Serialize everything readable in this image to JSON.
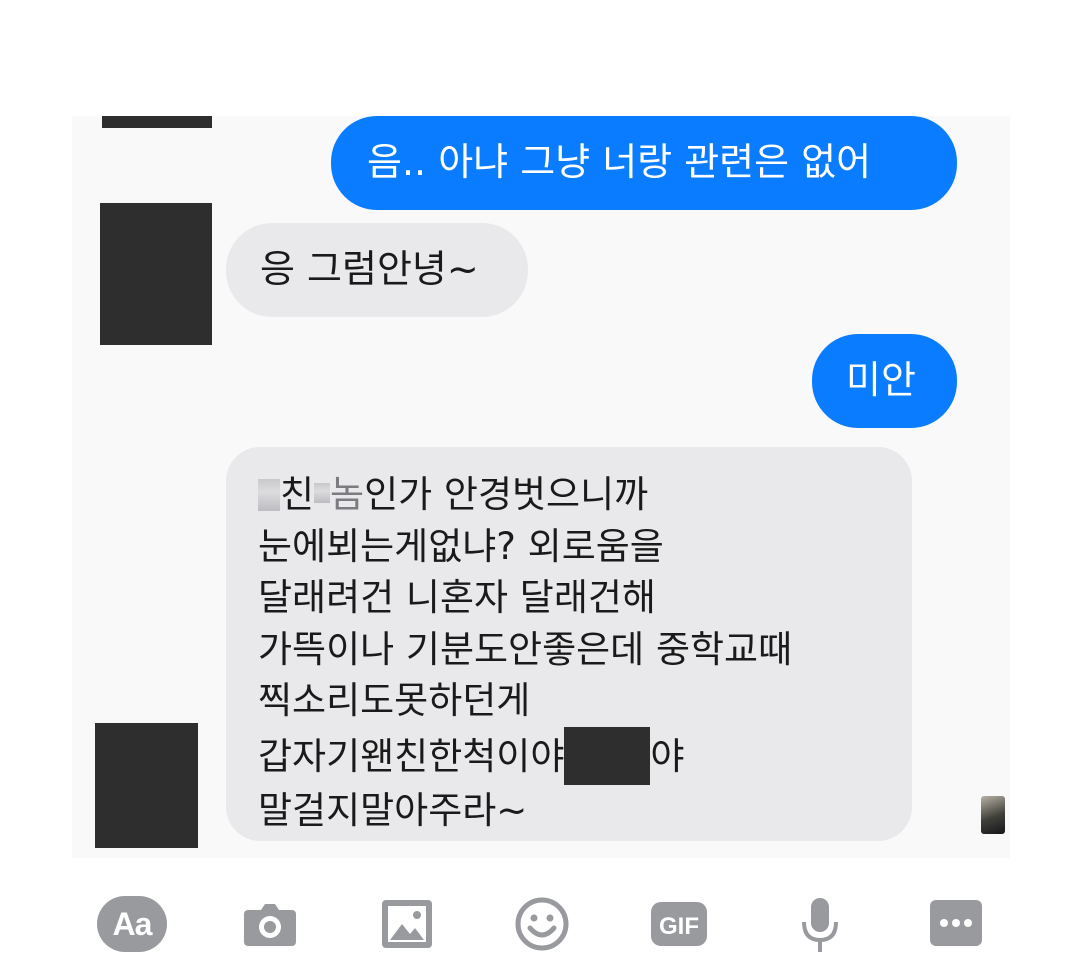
{
  "messages": [
    {
      "direction": "outgoing",
      "text": "음.. 아냐 그냥 너랑 관련은 없어"
    },
    {
      "direction": "incoming",
      "text": "응 그럼안녕~"
    },
    {
      "direction": "outgoing",
      "text": "미안"
    },
    {
      "direction": "incoming",
      "lines": [
        {
          "before": "",
          "blurred_1": "",
          "mid": "친",
          "blurred_2": "",
          "after": "인가 안경벗으니까"
        },
        {
          "text": "눈에뵈는게없냐? 외로움을"
        },
        {
          "text": "달래려건 니혼자 달래건해"
        },
        {
          "text": "가뜩이나 기분도안좋은데 중학교때"
        },
        {
          "text": "찍소리도못하던게"
        },
        {
          "before": "갑자기왠친한척이야",
          "after": "야"
        },
        {
          "text": "말걸지말아주라~"
        }
      ],
      "blur_partial": "놈"
    }
  ],
  "toolbar": {
    "text_button_label": "Aa",
    "icons": [
      "text-format-icon",
      "camera-icon",
      "image-icon",
      "emoji-icon",
      "gif-icon",
      "microphone-icon",
      "more-icon"
    ]
  },
  "colors": {
    "outgoing_bubble": "#0a7cff",
    "incoming_bubble": "#e9e9eb",
    "toolbar_icon": "#999a9e",
    "redaction": "#2e2e2e"
  }
}
